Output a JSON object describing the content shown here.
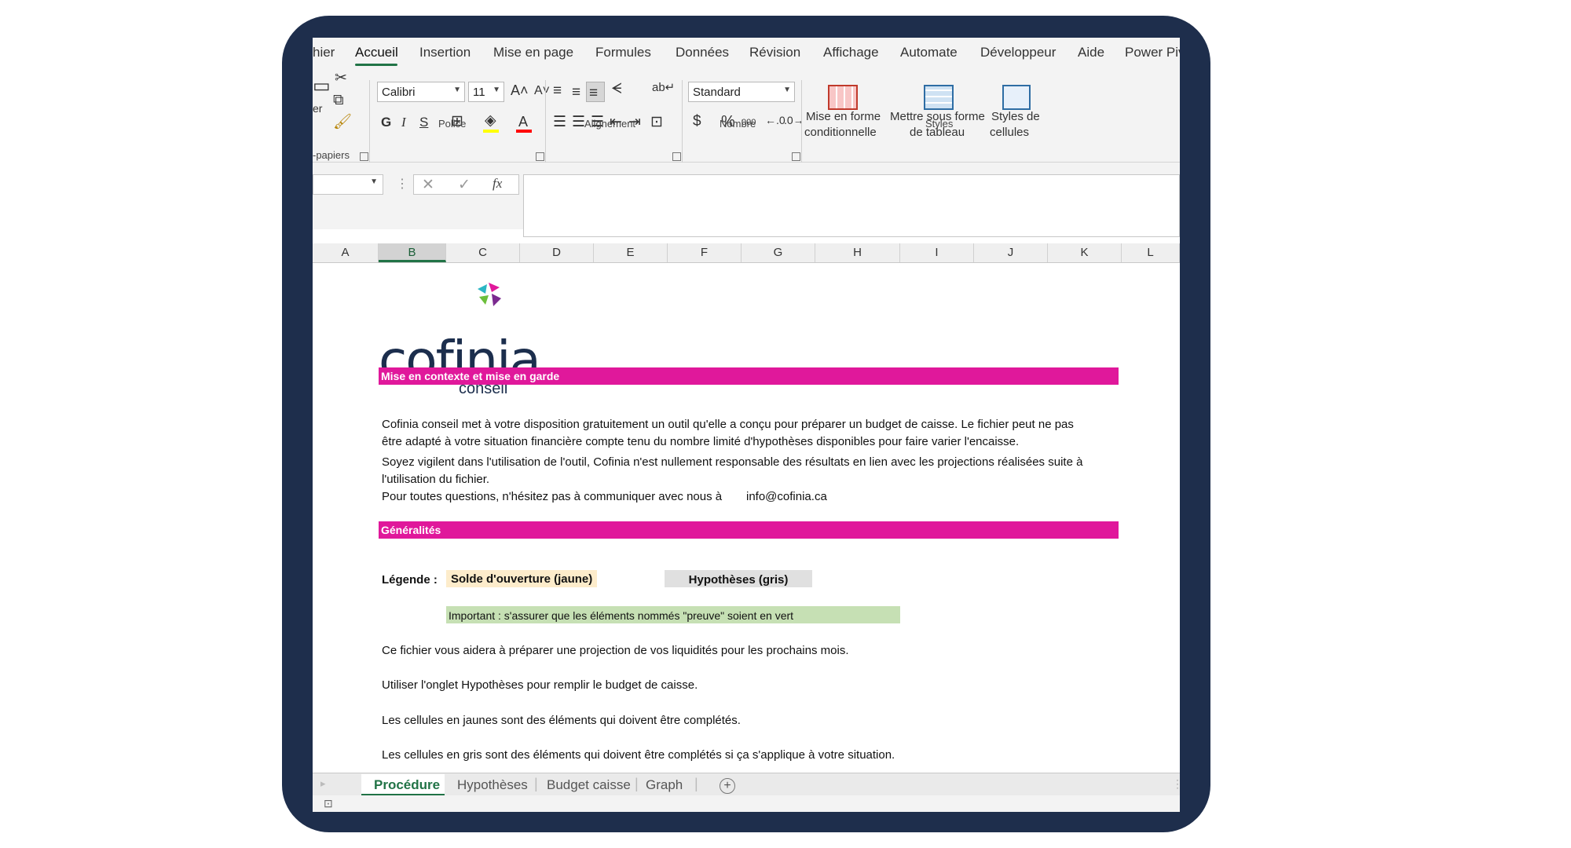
{
  "ribbon_tabs": [
    "hier",
    "Accueil",
    "Insertion",
    "Mise en page",
    "Formules",
    "Données",
    "Révision",
    "Affichage",
    "Automate",
    "Développeur",
    "Aide",
    "Power Pivo"
  ],
  "active_tab": "Accueil",
  "ribbon": {
    "clipboard_label": "-papiers",
    "paste_label_partial": "er",
    "font_name": "Calibri",
    "font_size": "11",
    "font_group_label": "Police",
    "align_group_label": "Alignement",
    "number_format": "Standard",
    "number_group_label": "Nombre",
    "styles_group_label": "Styles",
    "bold": "G",
    "italic": "I",
    "underline": "S",
    "cond_format_l1": "Mise en forme",
    "cond_format_l2": "conditionnelle",
    "table_format_l1": "Mettre sous forme",
    "table_format_l2": "de tableau",
    "cell_styles_l1": "Styles de",
    "cell_styles_l2": "cellules",
    "currency": "$",
    "percent": "%",
    "thousands": "000",
    "fx": "fx"
  },
  "columns": [
    "A",
    "B",
    "C",
    "D",
    "E",
    "F",
    "G",
    "H",
    "I",
    "J",
    "K",
    "L"
  ],
  "selected_column": "B",
  "logo": {
    "word": "cofinia",
    "sub": "conseil"
  },
  "sections": {
    "context_title": "Mise en contexte et mise en garde",
    "general_title": "Généralités"
  },
  "context_lines": [
    "Cofinia conseil met à votre disposition gratuitement un outil qu'elle a conçu pour préparer un budget de caisse. Le fichier peut ne pas",
    "être adapté à votre situation financière compte tenu du nombre limité d'hypothèses disponibles  pour faire varier l'encaisse.",
    "Soyez vigilent dans l'utilisation de l'outil, Cofinia n'est nullement responsable des résultats en lien avec les projections réalisées suite à",
    "l'utilisation du fichier.",
    "Pour toutes questions, n'hésitez pas à communiquer avec nous à"
  ],
  "email": "info@cofinia.ca",
  "legend": {
    "label": "Légende :",
    "yellow": "Solde d'ouverture (jaune)",
    "grey": "Hypothèses (gris)",
    "important": "Important : s'assurer que les éléments nommés \"preuve\" soient en vert"
  },
  "body_lines": [
    "Ce fichier vous aidera à préparer une projection de vos liquidités pour les prochains mois.",
    "Utiliser l'onglet Hypothèses pour remplir le budget de caisse.",
    "Les cellules en jaunes sont des éléments qui doivent être complétés.",
    "Les cellules en gris sont des éléments qui doivent être complétés si ça s'applique à votre situation."
  ],
  "sheet_tabs": [
    "Procédure",
    "Hypothèses",
    "Budget caisse",
    "Graph"
  ],
  "active_sheet": "Procédure",
  "colors": {
    "accent": "#217346",
    "band": "#e0189b",
    "yellow": "#fdeccb",
    "grey": "#e0e0e0",
    "green": "#c6e0b4",
    "frame": "#1e2e4c"
  }
}
